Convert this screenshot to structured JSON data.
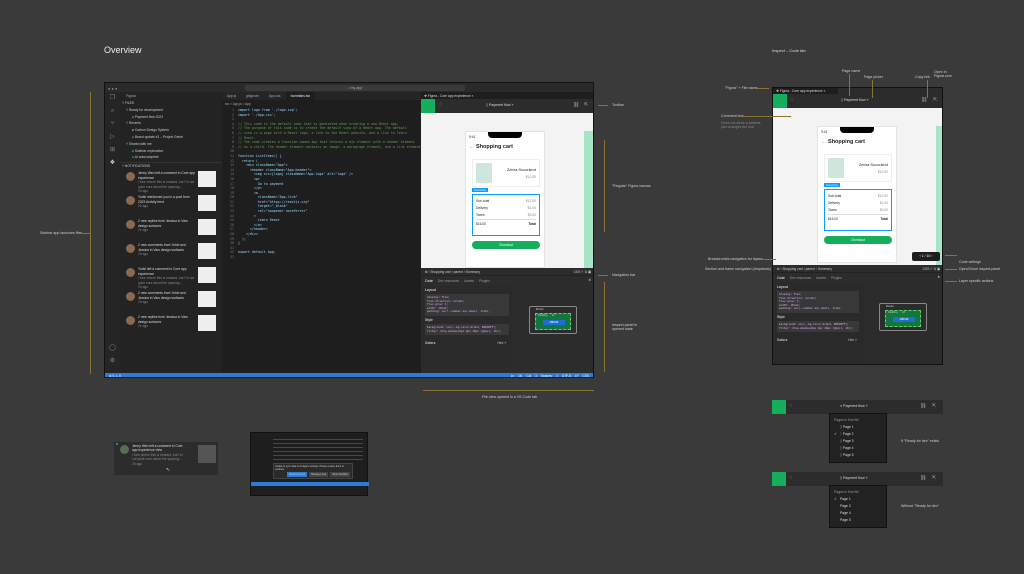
{
  "headings": {
    "overview": "Overview",
    "inspect": "Inspect – Code tab"
  },
  "vscode": {
    "search": "my-app",
    "sidebar_title": "Figma",
    "files_header": "FILES",
    "groups": [
      {
        "label": "Ready for development",
        "items": [
          "Payment flow 2023"
        ]
      },
      {
        "label": "Recents",
        "items": [
          "Carbon Design System",
          "Brand update #1 – Project Genie"
        ]
      },
      {
        "label": "Shared with me",
        "items": [
          "Sidebar exploration",
          "AI autocomplete"
        ]
      }
    ],
    "notifications_header": "NOTIFICATIONS",
    "notifications": [
      {
        "text": "Jenny Wen left a comment in Core app experience",
        "body": "I love where this is headed, but I'm not quite sure about the spacing…",
        "time": "2h ago"
      },
      {
        "text": "Yuhki mentioned you in a post from 2023 Activity feed",
        "body": "",
        "time": "2h ago"
      },
      {
        "text": "2 new replies from Jessica in Vars design surfaces",
        "body": "",
        "time": "2h ago"
      },
      {
        "text": "2 new comments from Yuhki and Jessica in Vars design surfaces",
        "body": "",
        "time": "2h ago"
      },
      {
        "text": "Yuhki left a comment in Core app experience",
        "body": "I love where this is headed, but I'm not quite sure about the spacing…",
        "time": "2h ago"
      },
      {
        "text": "2 new comments from Yuhki and Jessica in Vars design surfaces",
        "body": "",
        "time": "2h ago"
      },
      {
        "text": "2 new replies from Jessica in Vars design surfaces",
        "body": "",
        "time": "2h ago"
      }
    ],
    "tabs": [
      "App.js",
      "gitignore",
      "App.css",
      "homelabs.tsx"
    ],
    "figma_tab": "Figma - Core app experience",
    "breadcrumb": "src > App.js > App",
    "code": [
      "import logo from './logo.svg';",
      "import './App.css';",
      "",
      "// This code is the default code that is generated when creating a new React app.",
      "// The purpose of this code is to create the default view of a React app. The default",
      "// view is a page with a React logo, a link to the React website, and a link to learn",
      "// React.",
      "// The code creates a function named App that returns a div element with a header element",
      "// as a child. The header element contains an image, a paragraph element, and a link element.",
      "",
      "function ListItems() {",
      "  return (",
      "    <div className=\"App\">",
      "      <header className=\"App-header\">",
      "        <img src={logo} className=\"App-logo\" alt=\"logo\" />",
      "        <p>",
      "          Go to payment",
      "        </p>",
      "        <a",
      "          className=\"App-link\"",
      "          href=\"https://reactjs.org\"",
      "          target=\"_blank\"",
      "          rel=\"noopener noreferrer\"",
      "        >",
      "          Learn React",
      "        </a>",
      "      </header>",
      "    </div>",
      "  );",
      "}",
      "",
      "export default App;",
      ""
    ],
    "status_left": "⊗ 0 ⚠ 0",
    "status_right": [
      "Ln 16, Col 3",
      "Spaces: 2",
      "UTF-8",
      "LF",
      "CSS"
    ]
  },
  "figma": {
    "page": "Payment flow",
    "phone": {
      "time": "9:41",
      "title": "Shopping cart",
      "product": "Zebra Succulent",
      "price": "$12.00",
      "tag": "Summary",
      "rows": [
        [
          "Sub-total",
          "$12.00"
        ],
        [
          "Delivery",
          "$1.00"
        ],
        [
          "Taxes",
          "$3.00"
        ]
      ],
      "total_value": "$16.00",
      "total_label": "Total",
      "button": "Checkout"
    },
    "nav": {
      "crumbs": [
        "Shopping cart",
        "parent",
        "Summary"
      ],
      "lang": "CSS",
      "pager": "1 / 10"
    },
    "inspect_tabs": [
      "Code",
      "Dev resources",
      "Assets",
      "Plugins"
    ],
    "layout_label": "Layout",
    "layout_code": [
      "display: flex;",
      "flex-direction: column;",
      "flex-grow: 1;",
      "width: 18rem;",
      "padding: var(--number-spc-small, 1rem);"
    ],
    "style_label": "Style",
    "style_code": [
      "background: var(--bg-color-brand, #0D99FF);",
      "filter: drop-shadow(0px 4px 10px rgba(1, 10));"
    ],
    "colors_label": "Colors",
    "colors_value": "Hex",
    "box": {
      "border": "Border",
      "padding": "Padding",
      "padding_val": "16",
      "content": "288×96",
      "side": "16"
    }
  },
  "annotations": {
    "toolbar": "Toolbar",
    "canvas": "\"Regular\" Figma canvas",
    "navbar": "Navigation bar",
    "inspect": "Inspect panel in opened state",
    "sidebar": "Sidebar app launches files",
    "file_view": "File view opened in a VS Code tab",
    "file_name": "\"Figma\" + File name",
    "page_name": "Page name",
    "page_picker": "Page picker",
    "copy_link": "Copy link",
    "open_in": "Open in Figma.com",
    "comment_tool": "Comment tool",
    "comment_desc": "Does not show a sidebar, just changes the tool",
    "breadcrumbs": "Breadcrumbs navigation for layers",
    "section_nav": "Section and frame navigation (dropdown)",
    "code_settings": "Code settings",
    "open_close": "Open/Close inspect panel",
    "layer_actions": "Layer specific actions",
    "ready": "If \"Ready for dev\" exists",
    "without": "Without \"Ready for dev\""
  },
  "dropdowns": [
    {
      "title": "Pages in this file",
      "pages": [
        "Page 1",
        "Page 2",
        "Page 3",
        "Page 4",
        "Page 5"
      ],
      "checked": "Page 2"
    },
    {
      "title": "Pages in this file",
      "pages": [
        "Page 1",
        "Page 2",
        "Page 4",
        "Page 5"
      ],
      "checked": "Page 1"
    }
  ],
  "snippet_card": {
    "text": "Jenny Wen left a comment in Core app experience view",
    "body": "I love where this is headed, but I'm not quite sure about the spacing…",
    "time": "2h ago"
  },
  "snippet_dialog": {
    "text": "Unable to sync data to configure settings. Please resolve them to continue.",
    "buttons": [
      "Resolve issues",
      "Manage Local",
      "Show Conflicts"
    ]
  },
  "colors": {
    "brand_green": "#14ae5c",
    "status_blue": "#2d7bd6",
    "selection_blue": "#0d99ff"
  }
}
